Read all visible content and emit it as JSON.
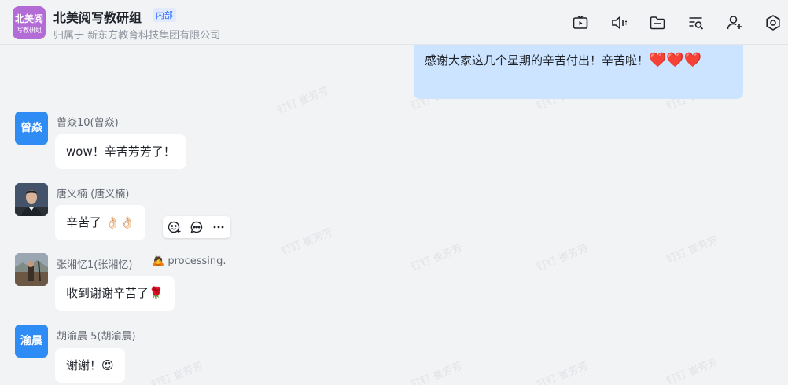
{
  "header": {
    "group_avatar_line1": "北美阅",
    "group_avatar_line2": "写教研组",
    "title": "北美阅写教研组",
    "tag": "内部",
    "subtitle": "归属于 新东方教育科技集团有限公司",
    "toolbar_icons": [
      "tv-icon",
      "speaker-icon",
      "folder-icon",
      "search-list-icon",
      "add-member-icon",
      "settings-icon"
    ]
  },
  "watermark": "钉钉 崔芳芳",
  "messages": {
    "self": {
      "text": "感谢大家这几个星期的辛苦付出！辛苦啦！",
      "emoji": "❤️❤️❤️"
    },
    "m1": {
      "avatar_text": "曾焱",
      "sender": "曾焱10(曾焱)",
      "text": "wow！辛苦芳芳了！"
    },
    "m2": {
      "sender": "唐义楠 (唐义楠)",
      "text": "辛苦了",
      "emoji": "👌🏻👌🏻"
    },
    "m3": {
      "sender": "张湘忆1(张湘忆)",
      "status_emoji": "🙇",
      "status": "processing.",
      "text": "收到谢谢辛苦了",
      "emoji": "🌹"
    },
    "m4": {
      "avatar_text": "渝晨",
      "sender": "胡渝晨 5(胡渝晨)",
      "text": "谢谢！",
      "emoji": "😍"
    }
  },
  "colors": {
    "accent": "#3370ff",
    "self_bubble": "#cce4ff",
    "avatar_blue": "#2f8cf4",
    "group_avatar": "#b36bd6"
  }
}
